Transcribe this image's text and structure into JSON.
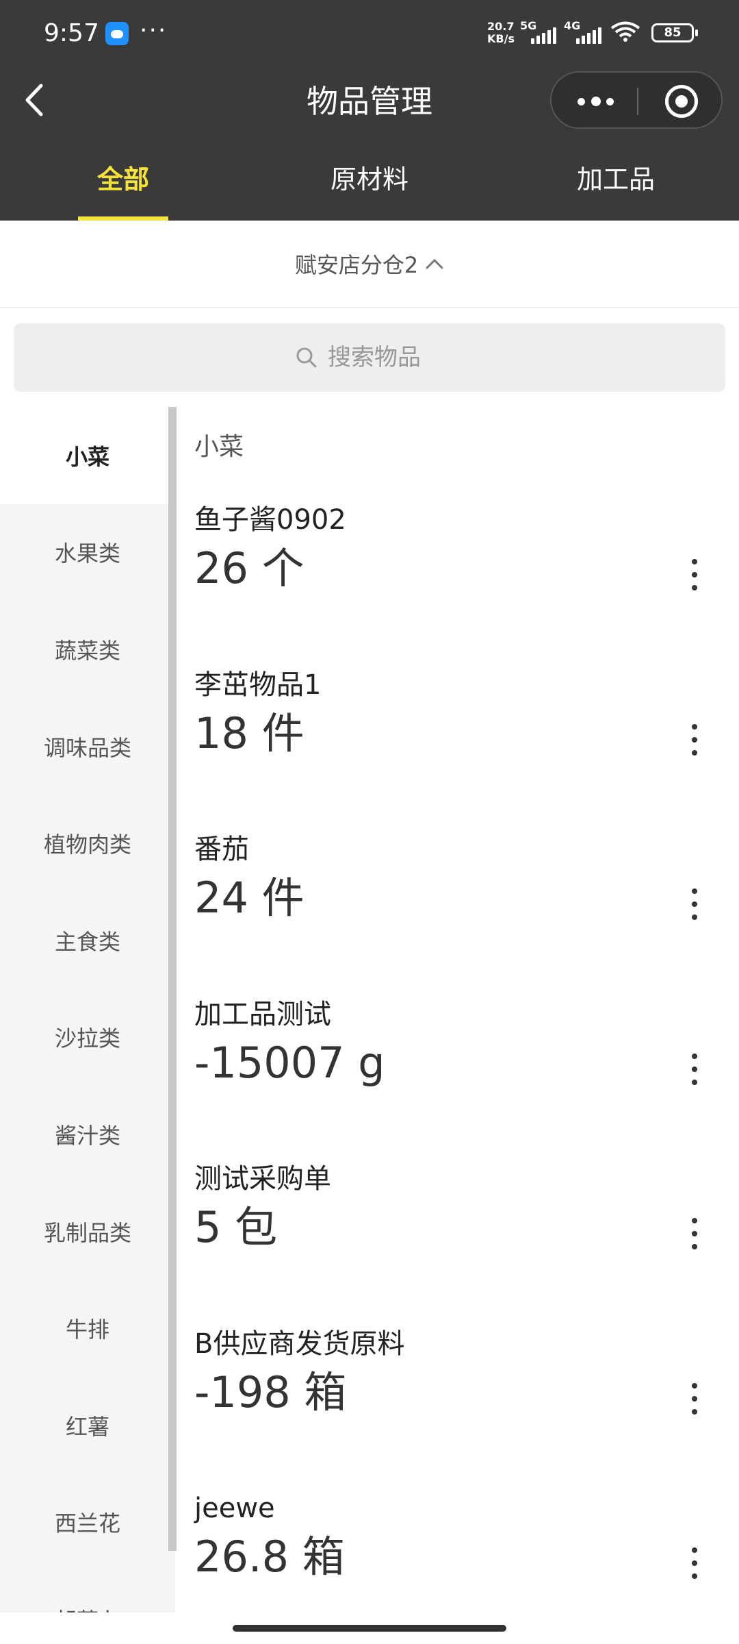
{
  "status_bar": {
    "time": "9:57",
    "more": "···",
    "net_speed_value": "20.7",
    "net_speed_unit": "KB/s",
    "sig1": "5G",
    "sig2": "4G",
    "battery": "85"
  },
  "header": {
    "title": "物品管理"
  },
  "tabs": [
    {
      "label": "全部",
      "active": true
    },
    {
      "label": "原材料",
      "active": false
    },
    {
      "label": "加工品",
      "active": false
    }
  ],
  "warehouse": {
    "label": "赋安店分仓2"
  },
  "search": {
    "placeholder": "搜索物品"
  },
  "categories": [
    {
      "label": "小菜",
      "active": true
    },
    {
      "label": "水果类"
    },
    {
      "label": "蔬菜类"
    },
    {
      "label": "调味品类"
    },
    {
      "label": "植物肉类"
    },
    {
      "label": "主食类"
    },
    {
      "label": "沙拉类"
    },
    {
      "label": "酱汁类"
    },
    {
      "label": "乳制品类"
    },
    {
      "label": "牛排"
    },
    {
      "label": "红薯"
    },
    {
      "label": "西兰花"
    },
    {
      "label": "胡萝卜"
    }
  ],
  "list": {
    "section_title": "小菜",
    "items": [
      {
        "name": "鱼子酱0902",
        "qty": "26 个"
      },
      {
        "name": "李茁物品1",
        "qty": "18 件"
      },
      {
        "name": "番茄",
        "qty": "24 件"
      },
      {
        "name": "加工品测试",
        "qty": "-15007 g"
      },
      {
        "name": "测试采购单",
        "qty": "5 包"
      },
      {
        "name": "B供应商发货原料",
        "qty": "-198 箱"
      },
      {
        "name": "jeewe",
        "qty": "26.8 箱"
      }
    ]
  }
}
